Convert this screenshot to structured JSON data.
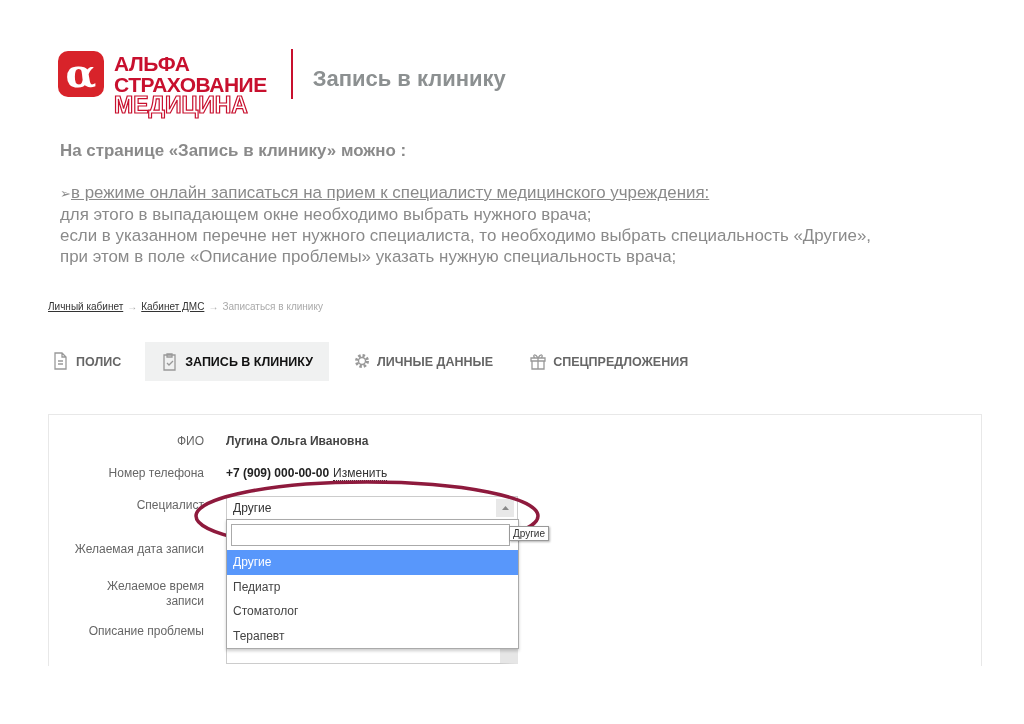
{
  "logo": {
    "mark": "α",
    "lines": [
      "АЛЬФА",
      "СТРАХОВАНИЕ",
      "МЕДИЦИНА"
    ]
  },
  "title": "Запись в клинику",
  "intro": {
    "heading": "На странице «Запись в клинику» можно :",
    "bullet": "➢",
    "lead": "в режиме онлайн записаться на прием к специалисту медицинского учреждения: ",
    "lines": [
      "для этого в выпадающем окне необходимо выбрать нужного врача;",
      "если в указанном перечне нет нужного специалиста, то необходимо выбрать специальность «Другие»,",
      "при этом в поле «Описание проблемы» указать нужную специальность врача;"
    ]
  },
  "breadcrumb": [
    {
      "label": "Личный кабинет",
      "kind": "link"
    },
    {
      "label": "→",
      "kind": "separator"
    },
    {
      "label": "Кабинет ДМС",
      "kind": "link"
    },
    {
      "label": "→",
      "kind": "separator"
    },
    {
      "label": "Записаться в клинику",
      "kind": "current"
    }
  ],
  "tabs": [
    {
      "label": "ПОЛИС",
      "selected": false
    },
    {
      "label": "ЗАПИСЬ В КЛИНИКУ",
      "selected": true
    },
    {
      "label": "ЛИЧНЫЕ ДАННЫЕ",
      "selected": false
    },
    {
      "label": "СПЕЦПРЕДЛОЖЕНИЯ",
      "selected": false
    }
  ],
  "form": {
    "fields": [
      {
        "kind": "text",
        "label": "ФИО",
        "value": "Лугина Ольга Ивановна"
      },
      {
        "kind": "phone",
        "label": "Номер телефона",
        "value": "+7 (909) 000-00-00",
        "link": "Изменить"
      },
      {
        "kind": "select",
        "label": "Специалист",
        "value": "Другие",
        "expanded": true,
        "tooltip": "Другие",
        "options": [
          {
            "label": "Другие",
            "selected": true
          },
          {
            "label": "Педиатр",
            "selected": false
          },
          {
            "label": "Стоматолог",
            "selected": false
          },
          {
            "label": "Терапевт",
            "selected": false
          }
        ]
      },
      {
        "kind": "hidden",
        "label": "Желаемая дата записи"
      },
      {
        "kind": "hidden",
        "label": "Желаемое время записи"
      },
      {
        "kind": "textarea",
        "label": "Описание проблемы"
      }
    ]
  }
}
